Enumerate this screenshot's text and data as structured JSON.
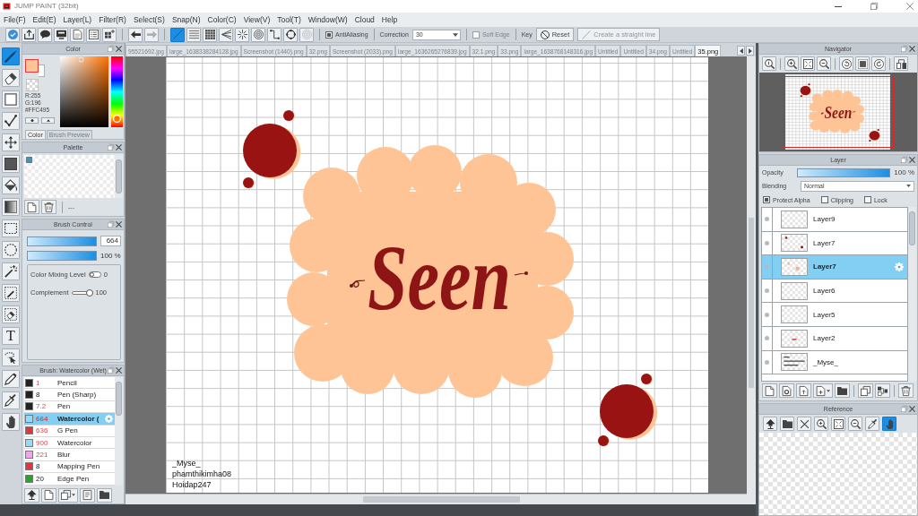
{
  "window": {
    "title": "JUMP PAINT (32bit)"
  },
  "menu": [
    "File(F)",
    "Edit(E)",
    "Layer(L)",
    "Filter(R)",
    "Select(S)",
    "Snap(N)",
    "Color(C)",
    "View(V)",
    "Tool(T)",
    "Window(W)",
    "Cloud",
    "Help"
  ],
  "toolbar": {
    "history": [
      {
        "kind": "undo",
        "disabled": false
      },
      {
        "kind": "redo",
        "disabled": true
      }
    ],
    "snap_modes": [
      {
        "kind": "off",
        "selected": true,
        "disabled": false
      },
      {
        "kind": "parallel",
        "selected": false,
        "disabled": false
      },
      {
        "kind": "grid",
        "selected": false,
        "disabled": false
      },
      {
        "kind": "perspective",
        "selected": false,
        "disabled": false
      },
      {
        "kind": "radial",
        "selected": false,
        "disabled": false
      },
      {
        "kind": "concentric",
        "selected": false,
        "disabled": false
      },
      {
        "kind": "curve",
        "selected": false,
        "disabled": false
      },
      {
        "kind": "circle",
        "selected": false,
        "disabled": false
      },
      {
        "kind": "concentric",
        "selected": false,
        "disabled": true
      }
    ],
    "antialiasing": {
      "label": "AntiAliasing",
      "checked": true
    },
    "correction": {
      "label": "Correction",
      "value": "30"
    },
    "soft_edge": {
      "label": "Soft Edge",
      "checked": false,
      "disabled": true
    },
    "key_label": "Key",
    "reset_button": "Reset",
    "straight_line_button": {
      "label": "Create a straight line",
      "disabled": true
    }
  },
  "document_tabs": [
    {
      "label": "95521692.jpg",
      "selected": false
    },
    {
      "label": "large_1638338284128.jpg",
      "selected": false
    },
    {
      "label": "Screenshot (1440).png",
      "selected": false
    },
    {
      "label": "32.png",
      "selected": false
    },
    {
      "label": "Screenshot (2033).png",
      "selected": false
    },
    {
      "label": "large_1636265276839.jpg",
      "selected": false
    },
    {
      "label": "32.1.png",
      "selected": false
    },
    {
      "label": "33.png",
      "selected": false
    },
    {
      "label": "large_1638768148316.jpg",
      "selected": false
    },
    {
      "label": "Untitled",
      "selected": false
    },
    {
      "label": "Untitled",
      "selected": false
    },
    {
      "label": "34.png",
      "selected": false
    },
    {
      "label": "Untitled",
      "selected": false
    },
    {
      "label": "35.png",
      "selected": true
    }
  ],
  "tools": [
    {
      "kind": "brush",
      "selected": true
    },
    {
      "kind": "eraser",
      "selected": false
    },
    {
      "kind": "shape",
      "selected": false
    },
    {
      "kind": "line",
      "selected": false
    },
    {
      "kind": "move",
      "selected": false
    },
    {
      "kind": "fill",
      "selected": false
    },
    {
      "kind": "bucket",
      "selected": false
    },
    {
      "kind": "gradient",
      "selected": false
    },
    {
      "kind": "select-rect",
      "selected": false
    },
    {
      "kind": "select-lasso",
      "selected": false
    },
    {
      "kind": "magic-wand",
      "selected": false
    },
    {
      "kind": "select-pen",
      "selected": false
    },
    {
      "kind": "select-eraser",
      "selected": false
    },
    {
      "kind": "text",
      "glyph": "T",
      "selected": false
    },
    {
      "kind": "select-auto",
      "selected": false
    },
    {
      "kind": "pen",
      "selected": false
    },
    {
      "kind": "eyedropper",
      "selected": false
    },
    {
      "kind": "hand",
      "selected": false
    }
  ],
  "color_panel": {
    "title": "Color",
    "swatches": [
      {
        "kind": "foreground",
        "color": "#ffc495",
        "selected": true
      },
      {
        "kind": "background",
        "color": "#ffffff",
        "selected": false
      }
    ],
    "readouts": [
      "R:255",
      "G:196",
      "#FFC495"
    ],
    "tabs": [
      {
        "label": "Color",
        "selected": true
      },
      {
        "label": "Brush Preview",
        "selected": false
      }
    ]
  },
  "palette": {
    "title": "Palette",
    "swatches": [
      {
        "color": "#4d8fae"
      }
    ],
    "footer_text": "---"
  },
  "brush_control": {
    "title": "Brush Control",
    "size": {
      "level": 1,
      "value": "664"
    },
    "opacity": {
      "level": 1,
      "reading": "100 %"
    },
    "color_mixing": {
      "label": "Color Mixing Level",
      "on": false,
      "value": "0"
    },
    "complement": {
      "label": "Complement",
      "level": 1,
      "value": "100"
    }
  },
  "brush_list": {
    "title": "Brush: Watercolor (Wet)",
    "items": [
      {
        "color": "#222222",
        "size": "1",
        "size_highlighted": true,
        "name": "Pencil",
        "selected": false
      },
      {
        "color": "#222222",
        "size": "8",
        "size_highlighted": false,
        "name": "Pen (Sharp)",
        "selected": false
      },
      {
        "color": "#222222",
        "size": "7.2",
        "size_highlighted": true,
        "name": "Pen",
        "selected": false
      },
      {
        "color": "#8fdcff",
        "size": "664",
        "size_highlighted": true,
        "name": "Watercolor (",
        "selected": true
      },
      {
        "color": "#e8333a",
        "size": "636",
        "size_highlighted": true,
        "name": "G Pen",
        "selected": false
      },
      {
        "color": "#8fdcff",
        "size": "900",
        "size_highlighted": true,
        "name": "Watercolor",
        "selected": false
      },
      {
        "color": "#f5a3ef",
        "size": "221",
        "size_highlighted": true,
        "name": "Blur",
        "selected": false
      },
      {
        "color": "#e8333a",
        "size": "8",
        "size_highlighted": false,
        "name": "Mapping Pen",
        "selected": false
      },
      {
        "color": "#1faa1f",
        "size": "20",
        "size_highlighted": false,
        "name": "Edge Pen",
        "selected": false
      }
    ]
  },
  "canvas": {
    "lettering": "Seen",
    "signature": [
      "_Myse_",
      "phamthikimha08",
      "Hoidap247"
    ]
  },
  "navigator": {
    "title": "Navigator",
    "preview_lettering": "Seen"
  },
  "layer_panel": {
    "title": "Layer",
    "opacity": {
      "label": "Opacity",
      "level": 1,
      "reading": "100 %"
    },
    "blending": {
      "label": "Blending",
      "value": "Normal"
    },
    "options": [
      {
        "label": "Protect Alpha",
        "checked": true
      },
      {
        "label": "Clipping",
        "checked": false
      },
      {
        "label": "Lock",
        "checked": false
      }
    ],
    "layers": [
      {
        "name": "Layer9",
        "thumbnail": {
          "kind": "blank"
        },
        "selected": false
      },
      {
        "name": "Layer7",
        "thumbnail": {
          "kind": "dots"
        },
        "selected": false
      },
      {
        "name": "Layer7",
        "thumbnail": {
          "kind": "faint"
        },
        "selected": true
      },
      {
        "name": "Layer6",
        "thumbnail": {
          "kind": "blank"
        },
        "selected": false
      },
      {
        "name": "Layer5",
        "thumbnail": {
          "kind": "blank"
        },
        "selected": false
      },
      {
        "name": "Layer2",
        "thumbnail": {
          "kind": "dash"
        },
        "selected": false
      },
      {
        "name": "_Myse_",
        "thumbnail": {
          "kind": "text"
        },
        "selected": false
      }
    ]
  },
  "reference": {
    "title": "Reference",
    "tools": [
      {
        "kind": "upload",
        "selected": false
      },
      {
        "kind": "folder",
        "selected": false
      },
      {
        "kind": "close",
        "selected": false
      },
      {
        "kind": "zoom-in",
        "selected": false
      },
      {
        "kind": "fit",
        "selected": false
      },
      {
        "kind": "zoom-out",
        "selected": false
      },
      {
        "kind": "eyedropper",
        "selected": false
      },
      {
        "kind": "hand",
        "selected": true
      }
    ]
  }
}
